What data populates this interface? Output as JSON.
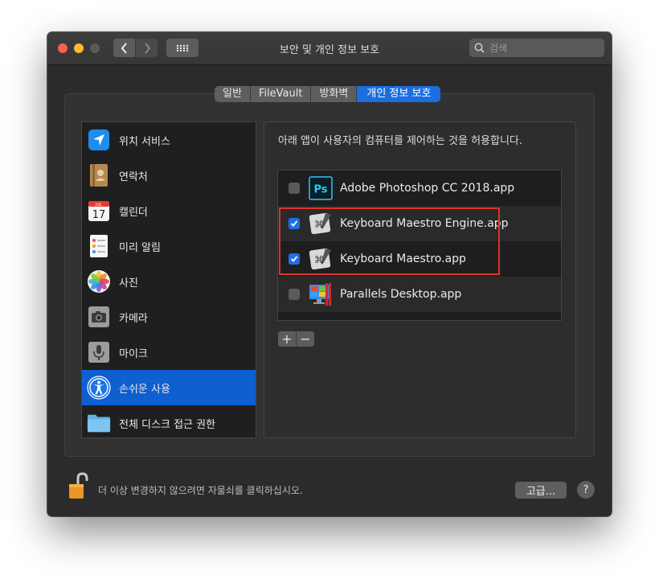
{
  "window": {
    "title": "보안 및 개인 정보 보호"
  },
  "search": {
    "placeholder": "검색"
  },
  "tabs": [
    {
      "label": "일반"
    },
    {
      "label": "FileVault"
    },
    {
      "label": "방화벽"
    },
    {
      "label": "개인 정보 보호",
      "selected": true
    }
  ],
  "sidebar": {
    "items": [
      {
        "label": "위치 서비스",
        "icon": "location-arrow-icon"
      },
      {
        "label": "연락처",
        "icon": "contacts-book-icon"
      },
      {
        "label": "캘린더",
        "icon": "calendar-icon",
        "day": "17",
        "month": "JUL"
      },
      {
        "label": "미리 알림",
        "icon": "reminders-icon"
      },
      {
        "label": "사진",
        "icon": "photos-icon"
      },
      {
        "label": "카메라",
        "icon": "camera-icon"
      },
      {
        "label": "마이크",
        "icon": "microphone-icon"
      },
      {
        "label": "손쉬운 사용",
        "icon": "accessibility-icon",
        "selected": true
      },
      {
        "label": "전체 디스크 접근 권한",
        "icon": "folder-icon"
      }
    ]
  },
  "main": {
    "description": "아래 앱이 사용자의 컴퓨터를 제어하는 것을 허용합니다.",
    "apps": [
      {
        "name": "Adobe Photoshop CC 2018.app",
        "checked": false,
        "icon": "photoshop-icon",
        "icon_text": "Ps"
      },
      {
        "name": "Keyboard Maestro Engine.app",
        "checked": true,
        "icon": "keyboard-maestro-icon"
      },
      {
        "name": "Keyboard Maestro.app",
        "checked": true,
        "icon": "keyboard-maestro-icon"
      },
      {
        "name": "Parallels Desktop.app",
        "checked": false,
        "icon": "parallels-icon"
      }
    ],
    "add_label": "+",
    "remove_label": "−"
  },
  "footer": {
    "lock_text": "더 이상 변경하지 않으려면 자물쇠를 클릭하십시오.",
    "advanced_label": "고급...",
    "help_label": "?"
  },
  "colors": {
    "accent": "#1a6ee0",
    "highlight_box": "#e0302a",
    "close": "#fc5f57",
    "minimize": "#fdbc2e"
  }
}
